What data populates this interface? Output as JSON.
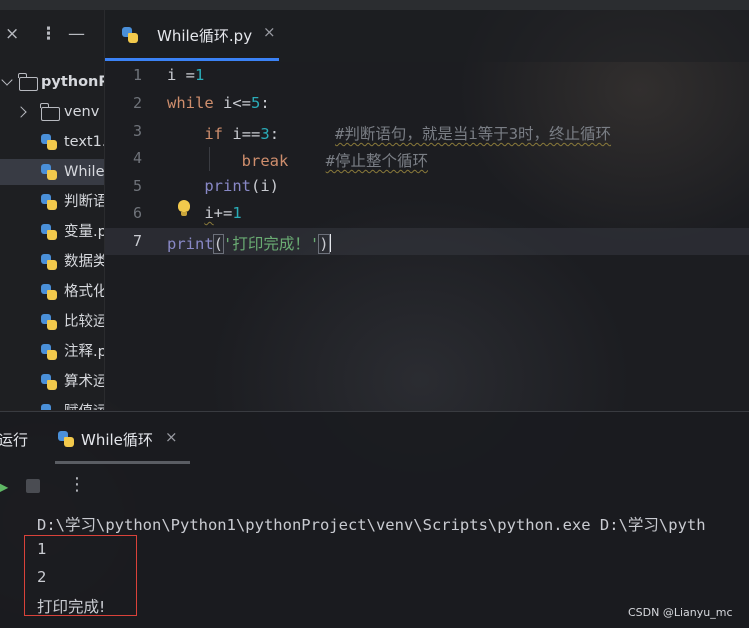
{
  "project_panel": {
    "root_label": "pythonP",
    "items": [
      {
        "label": "venv",
        "kind": "folder"
      },
      {
        "label": "text1.",
        "kind": "py"
      },
      {
        "label": "While",
        "kind": "py"
      },
      {
        "label": "判断语",
        "kind": "py"
      },
      {
        "label": "变量.p",
        "kind": "py"
      },
      {
        "label": "数据类",
        "kind": "py"
      },
      {
        "label": "格式化",
        "kind": "py"
      },
      {
        "label": "比较运",
        "kind": "py"
      },
      {
        "label": "注释.p",
        "kind": "py"
      },
      {
        "label": "算术运",
        "kind": "py"
      },
      {
        "label": "赋值运",
        "kind": "py"
      }
    ],
    "close_icon": "×",
    "more_icon": "⋮",
    "minimize_icon": "—"
  },
  "editor": {
    "tab_label": "While循环.py",
    "tab_close": "×",
    "line_numbers": [
      "1",
      "2",
      "3",
      "4",
      "5",
      "6",
      "7"
    ],
    "lines": {
      "l1_a": "i =",
      "l1_b": "1",
      "l2_a": "while",
      "l2_b": " i<=",
      "l2_c": "5",
      "l2_d": ":",
      "l3_a": "    ",
      "l3_b": "if",
      "l3_c": " ",
      "l3_d": "i",
      "l3_e": "==",
      "l3_f": "3",
      "l3_g": ":      ",
      "l3_h": "#判断语句，就是当i等于3时，终止循环",
      "l4_a": "        ",
      "l4_b": "break",
      "l4_c": "    ",
      "l4_d": "#停止整个循环",
      "l5_a": "    ",
      "l5_b": "print",
      "l5_c": "(i)",
      "l6_a": "    ",
      "l6_b": "i",
      "l6_c": "+=",
      "l6_d": "1",
      "l7_a": "print",
      "l7_b": "(",
      "l7_c": "'打印完成！'",
      "l7_d": ")"
    }
  },
  "run_panel": {
    "title": "运行",
    "tab_label": "While循环",
    "tab_close": "×",
    "more_icon": "⋮",
    "output": [
      "D:\\学习\\python\\Python1\\pythonProject\\venv\\Scripts\\python.exe D:\\学习\\pyth",
      "1",
      "2",
      "打印完成!"
    ]
  },
  "watermark": "CSDN @Lianyu_mc",
  "colors": {
    "accent": "#3b82f6",
    "highlight_box": "#d9423a"
  }
}
